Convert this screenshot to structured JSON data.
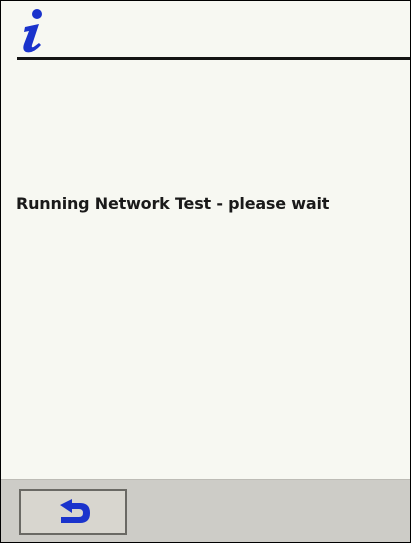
{
  "header": {
    "icon": "info-icon"
  },
  "main": {
    "message": "Running Network Test - please wait"
  },
  "bottom_bar": {
    "back_button_icon": "back-arrow-icon"
  },
  "colors": {
    "background": "#f7f8f2",
    "icon_blue": "#1a33cc",
    "bar": "#cdccc7"
  }
}
